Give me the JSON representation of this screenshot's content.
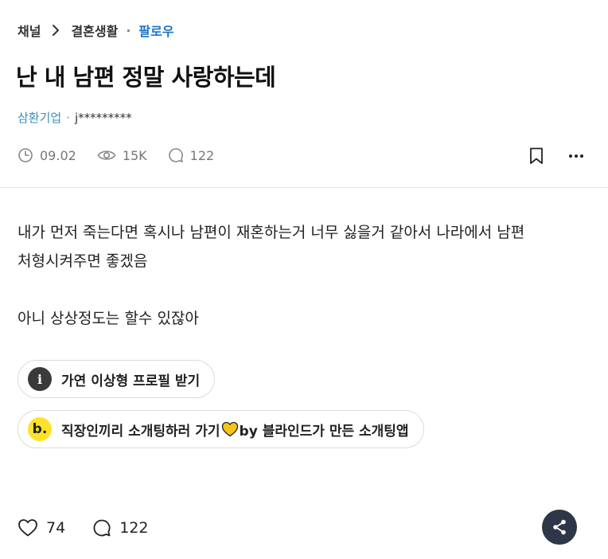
{
  "breadcrumb": {
    "channel": "채널",
    "category": "결혼생활",
    "separator": "·",
    "follow": "팔로우"
  },
  "post": {
    "title": "난 내 남편 정말 사랑하는데",
    "author": {
      "company": "삼환기업",
      "separator": "·",
      "nickname": "j*********"
    },
    "meta": {
      "date": "09.02",
      "views": "15K",
      "comments": "122"
    },
    "body": {
      "line1": "내가 먼저 죽는다면 혹시나 남편이 재혼하는거 너무 싫을거 같아서 나라에서 남편",
      "line2": "처형시켜주면 좋겠음",
      "line3": "아니 상상정도는 할수 있잖아"
    }
  },
  "promos": {
    "profile": {
      "icon": "i",
      "label": "가연 이상형 프로필 받기"
    },
    "dating": {
      "icon": "b.",
      "label_before": "직장인끼리 소개팅하러 가기",
      "label_after": " by 블라인드가 만든 소개팅앱"
    }
  },
  "footer": {
    "likes": "74",
    "comments": "122"
  },
  "icons": {
    "chevron": "chevron-right-icon",
    "clock": "clock-icon",
    "eye": "eye-icon",
    "comment": "comment-icon",
    "bookmark": "bookmark-icon",
    "more": "more-icon",
    "heart": "heart-icon",
    "share": "share-icon",
    "yellow_heart": "yellow-heart-icon"
  },
  "colors": {
    "follow": "#1a73c8",
    "company": "#3a8fb7",
    "share_bg": "#2d3747",
    "dating_icon_bg": "#ffe229",
    "heart_yellow": "#f5c518"
  }
}
